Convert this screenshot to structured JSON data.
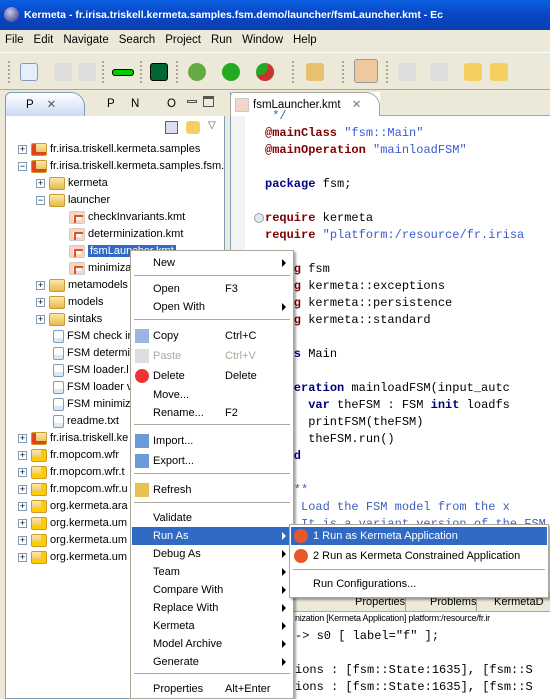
{
  "window": {
    "title": "Kermeta - fr.irisa.triskell.kermeta.samples.fsm.demo/launcher/fsmLauncher.kmt - Ec"
  },
  "menubar": [
    "File",
    "Edit",
    "Navigate",
    "Search",
    "Project",
    "Run",
    "Window",
    "Help"
  ],
  "left_tabs": [
    "P",
    "P",
    "N",
    "O"
  ],
  "tree": [
    {
      "label": "fr.irisa.triskell.kermeta.samples",
      "icon": "project-icon",
      "expander": "+",
      "indent": 0
    },
    {
      "label": "fr.irisa.triskell.kermeta.samples.fsm.",
      "icon": "project-icon",
      "expander": "-",
      "indent": 0
    },
    {
      "label": "kermeta",
      "icon": "folder-icon",
      "expander": "+",
      "indent": 1
    },
    {
      "label": "launcher",
      "icon": "folder-icon",
      "expander": "-",
      "indent": 1
    },
    {
      "label": "checkInvariants.kmt",
      "icon": "kmt-file-icon",
      "expander": "",
      "indent": 2
    },
    {
      "label": "determinization.kmt",
      "icon": "kmt-file-icon",
      "expander": "",
      "indent": 2
    },
    {
      "label": "fsmLauncher.kmt",
      "icon": "kmt-file-icon",
      "expander": "",
      "indent": 2,
      "selected": true
    },
    {
      "label": "minimiza",
      "icon": "kmt-file-icon",
      "expander": "",
      "indent": 2
    },
    {
      "label": "metamodels",
      "icon": "folder-icon",
      "expander": "+",
      "indent": 1
    },
    {
      "label": "models",
      "icon": "folder-icon",
      "expander": "+",
      "indent": 1
    },
    {
      "label": "sintaks",
      "icon": "folder-icon",
      "expander": "+",
      "indent": 1
    },
    {
      "label": "FSM check in",
      "icon": "file-icon",
      "expander": "",
      "indent": 1
    },
    {
      "label": "FSM determi",
      "icon": "file-icon",
      "expander": "",
      "indent": 1
    },
    {
      "label": "FSM loader.l",
      "icon": "file-icon",
      "expander": "",
      "indent": 1
    },
    {
      "label": "FSM loader v",
      "icon": "file-icon",
      "expander": "",
      "indent": 1
    },
    {
      "label": "FSM minimiza",
      "icon": "file-icon",
      "expander": "",
      "indent": 1
    },
    {
      "label": "readme.txt",
      "icon": "file-icon",
      "expander": "",
      "indent": 1
    },
    {
      "label": "fr.irisa.triskell.ke",
      "icon": "project-error-icon",
      "expander": "+",
      "indent": 0
    },
    {
      "label": "fr.mopcom.wfr",
      "icon": "project-warning-icon",
      "expander": "+",
      "indent": 0
    },
    {
      "label": "fr.mopcom.wfr.t",
      "icon": "project-warning-icon",
      "expander": "+",
      "indent": 0
    },
    {
      "label": "fr.mopcom.wfr.u",
      "icon": "project-warning-icon",
      "expander": "+",
      "indent": 0
    },
    {
      "label": "org.kermeta.ara",
      "icon": "project-warning-icon",
      "expander": "+",
      "indent": 0
    },
    {
      "label": "org.kermeta.um",
      "icon": "project-warning-icon",
      "expander": "+",
      "indent": 0
    },
    {
      "label": "org.kermeta.um",
      "icon": "project-warning-icon",
      "expander": "+",
      "indent": 0
    },
    {
      "label": "org.kermeta.um",
      "icon": "project-warning-icon",
      "expander": "+",
      "indent": 0
    }
  ],
  "editor": {
    "tab": "fsmLauncher.kmt",
    "lines": [
      [
        [
          "cm",
          " */"
        ]
      ],
      [
        [
          "kw",
          "@mainClass"
        ],
        [
          "",
          " "
        ],
        [
          "str",
          "\"fsm::Main\""
        ]
      ],
      [
        [
          "kw",
          "@mainOperation"
        ],
        [
          "",
          " "
        ],
        [
          "str",
          "\"mainloadFSM\""
        ]
      ],
      [],
      [
        [
          "kw2",
          "package"
        ],
        [
          "",
          " fsm;"
        ]
      ],
      [],
      [
        [
          "kw",
          "require"
        ],
        [
          "",
          " kermeta"
        ]
      ],
      [
        [
          "kw",
          "require"
        ],
        [
          "",
          " "
        ],
        [
          "str",
          "\"platform:/resource/fr.irisa"
        ]
      ],
      [],
      [
        [
          "kw",
          "using"
        ],
        [
          "",
          " fsm"
        ]
      ],
      [
        [
          "kw",
          "using"
        ],
        [
          "",
          " kermeta::exceptions"
        ]
      ],
      [
        [
          "kw",
          "using"
        ],
        [
          "",
          " kermeta::persistence"
        ]
      ],
      [
        [
          "kw",
          "using"
        ],
        [
          "",
          " kermeta::standard"
        ]
      ],
      [],
      [
        [
          "kw2",
          "class"
        ],
        [
          "",
          " Main"
        ]
      ],
      [],
      [
        [
          "",
          "  "
        ],
        [
          "kw2",
          "operation"
        ],
        [
          "",
          " mainloadFSM(input_autc"
        ]
      ],
      [
        [
          "",
          "      "
        ],
        [
          "kw2",
          "var"
        ],
        [
          "",
          " theFSM : FSM "
        ],
        [
          "kw2",
          "init"
        ],
        [
          "",
          " loadfs"
        ]
      ],
      [
        [
          "",
          "      printFSM(theFSM)"
        ]
      ],
      [
        [
          "",
          "      theFSM.run()"
        ]
      ],
      [
        [
          "",
          "  "
        ],
        [
          "kw2",
          "end"
        ]
      ],
      [],
      [
        [
          "cm",
          "   /**"
        ]
      ],
      [
        [
          "cm",
          "   * Load the FSM model from the x"
        ]
      ],
      [
        [
          "cm",
          "   * It is a variant version of the FSM"
        ]
      ]
    ]
  },
  "bottom": {
    "tabs": [
      "Properties",
      "Problems",
      "KermetaD"
    ],
    "console_header": "nization [Kermeta Application] platform:/resource/fr.ir",
    "console_lines": [
      "-> s0 [ label=\"f\" ];",
      "",
      "ions : [fsm::State:1635], [fsm::S",
      "ions : [fsm::State:1635], [fsm::S"
    ]
  },
  "context_menu": [
    {
      "label": "New",
      "submenu": true
    },
    {
      "sep": true
    },
    {
      "label": "Open",
      "shortcut": "F3"
    },
    {
      "label": "Open With",
      "submenu": true
    },
    {
      "sep": true
    },
    {
      "label": "Copy",
      "shortcut": "Ctrl+C",
      "icon": "copy-icon"
    },
    {
      "label": "Paste",
      "shortcut": "Ctrl+V",
      "icon": "paste-icon",
      "disabled": true
    },
    {
      "label": "Delete",
      "shortcut": "Delete",
      "icon": "delete-icon"
    },
    {
      "label": "Move..."
    },
    {
      "label": "Rename...",
      "shortcut": "F2"
    },
    {
      "sep": true
    },
    {
      "label": "Import...",
      "icon": "import-icon"
    },
    {
      "label": "Export...",
      "icon": "export-icon"
    },
    {
      "sep": true
    },
    {
      "label": "Refresh",
      "icon": "refresh-icon"
    },
    {
      "sep": true
    },
    {
      "label": "Validate"
    },
    {
      "label": "Run As",
      "submenu": true,
      "highlighted": true
    },
    {
      "label": "Debug As",
      "submenu": true
    },
    {
      "label": "Team",
      "submenu": true
    },
    {
      "label": "Compare With",
      "submenu": true
    },
    {
      "label": "Replace With",
      "submenu": true
    },
    {
      "label": "Kermeta",
      "submenu": true
    },
    {
      "label": "Model Archive",
      "submenu": true
    },
    {
      "label": "Generate",
      "submenu": true
    },
    {
      "sep": true
    },
    {
      "label": "Properties",
      "shortcut": "Alt+Enter"
    }
  ],
  "run_as_submenu": [
    {
      "label": "1 Run as Kermeta Application",
      "icon": "kermeta-icon",
      "highlighted": true
    },
    {
      "label": "2 Run as Kermeta Constrained Application",
      "icon": "kermeta-icon"
    },
    {
      "sep": true
    },
    {
      "label": "Run Configurations..."
    }
  ],
  "colors": {
    "selection": "#316ac5",
    "keyword": "#7f0000",
    "keyword2": "#000080",
    "string": "#3a5ad6",
    "titlebar": "#0846c4"
  }
}
